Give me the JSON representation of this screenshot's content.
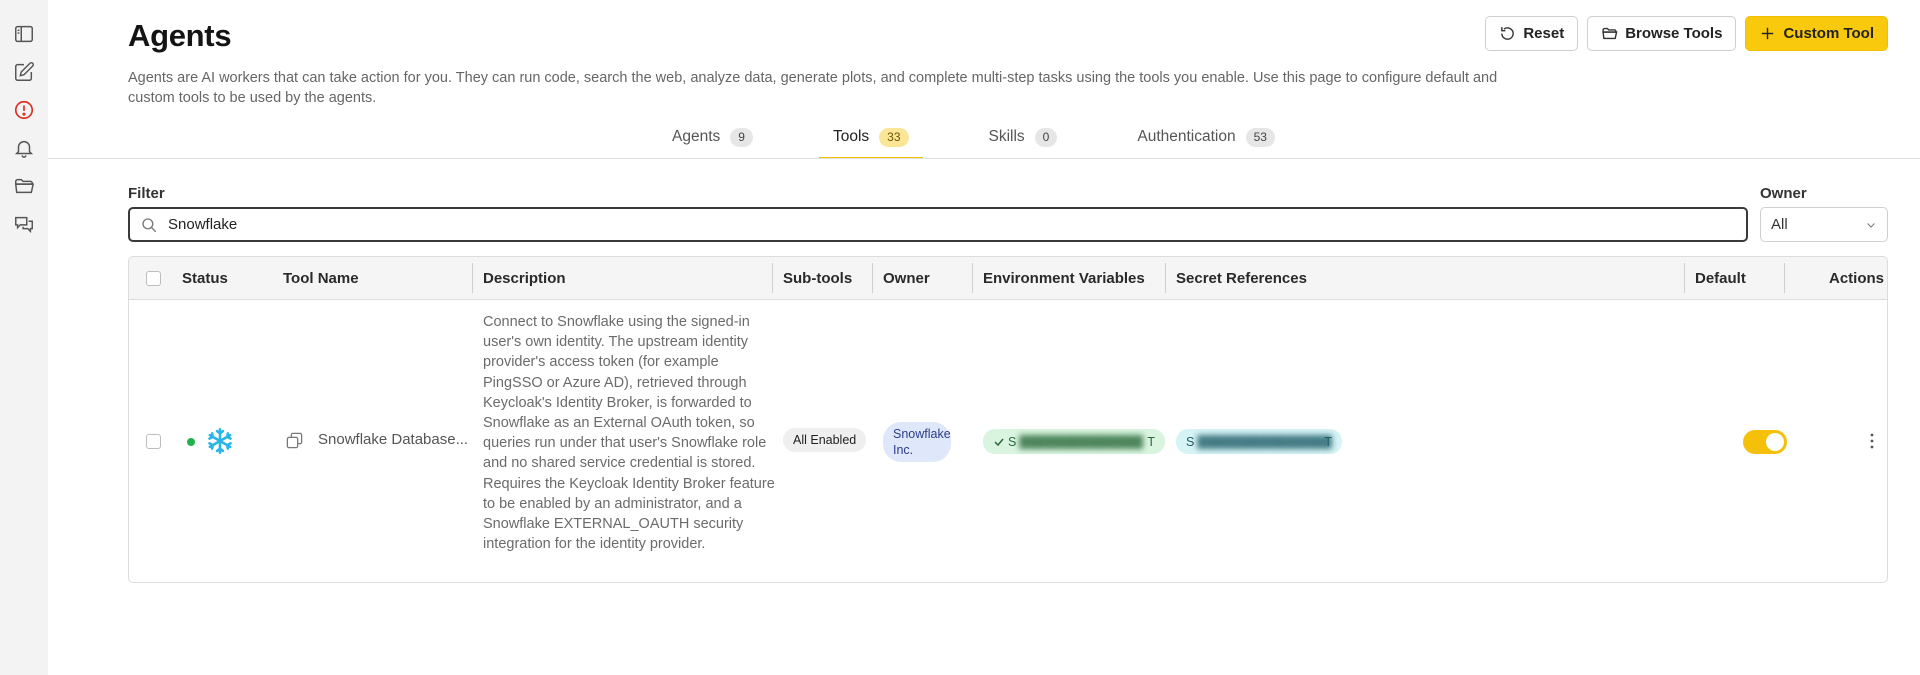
{
  "rail": {
    "items": [
      {
        "name": "sidebar-toggle-icon"
      },
      {
        "name": "new-chat-icon"
      },
      {
        "name": "alert-icon",
        "color": "#d93025"
      },
      {
        "name": "bell-icon"
      },
      {
        "name": "folder-icon"
      },
      {
        "name": "chat-bubbles-icon"
      }
    ]
  },
  "header": {
    "title": "Agents",
    "description": "Agents are AI workers that can take action for you. They can run code, search the web, analyze data, generate plots, and complete multi-step tasks using the tools you enable. Use this page to configure default and custom tools to be used by the agents."
  },
  "actions": {
    "reset_label": "Reset",
    "browse_label": "Browse Tools",
    "custom_label": "Custom Tool"
  },
  "tabs": [
    {
      "label": "Agents",
      "count": "9",
      "active": false
    },
    {
      "label": "Tools",
      "count": "33",
      "active": true
    },
    {
      "label": "Skills",
      "count": "0",
      "active": false
    },
    {
      "label": "Authentication",
      "count": "53",
      "active": false
    }
  ],
  "filter": {
    "label": "Filter",
    "value": "Snowflake"
  },
  "owner": {
    "label": "Owner",
    "value": "All"
  },
  "table": {
    "columns": {
      "status": "Status",
      "tool_name": "Tool Name",
      "description": "Description",
      "subtools": "Sub-tools",
      "owner": "Owner",
      "env": "Environment Variables",
      "secrets": "Secret References",
      "default": "Default",
      "actions": "Actions"
    },
    "rows": [
      {
        "status": "active",
        "tool_name": "Snowflake Database...",
        "description": "Connect to Snowflake using the signed-in user's own identity. The upstream identity provider's access token (for example PingSSO or Azure AD), retrieved through Keycloak's Identity Broker, is forwarded to Snowflake as an External OAuth token, so queries run under that user's Snowflake role and no shared service credential is stored. Requires the Keycloak Identity Broker feature to be enabled by an administrator, and a Snowflake EXTERNAL_OAUTH security integration for the identity provider.",
        "subtools": "All Enabled",
        "owner": "Snowflake Inc.",
        "env_first": "S",
        "env_last": "T",
        "secret_first": "S",
        "secret_last": "T",
        "default_enabled": true
      }
    ]
  },
  "colors": {
    "accent": "#f9c90e",
    "status_active": "#23b14d",
    "snowflake_brand": "#29b5e8"
  }
}
